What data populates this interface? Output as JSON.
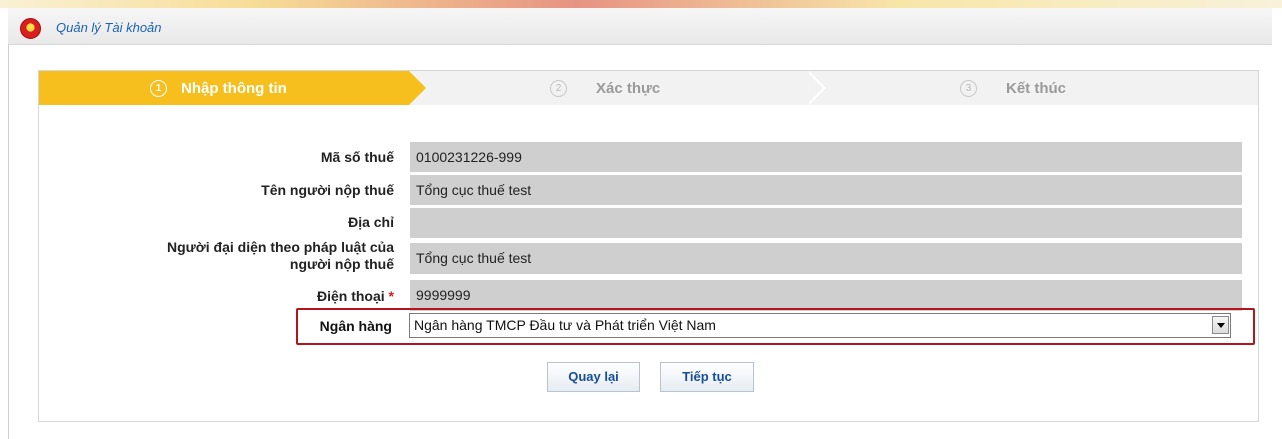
{
  "header": {
    "title": "Quản lý Tài khoản",
    "emblem_icon": "national-emblem-icon"
  },
  "wizard": {
    "steps": [
      {
        "number": "1",
        "label": "Nhập thông tin",
        "state": "active"
      },
      {
        "number": "2",
        "label": "Xác thực",
        "state": "inactive"
      },
      {
        "number": "3",
        "label": "Kết thúc",
        "state": "inactive"
      }
    ],
    "active_color": "#f6bf1e"
  },
  "form": {
    "fields": [
      {
        "label": "Mã số thuế",
        "value": "0100231226-999"
      },
      {
        "label": "Tên người nộp thuế",
        "value": "Tổng cục thuế test"
      },
      {
        "label": "Địa chỉ",
        "value": ""
      },
      {
        "label_line1": "Người đại diện theo pháp luật của",
        "label_line2": "người nộp thuế",
        "value": "Tổng cục thuế test"
      },
      {
        "label": "Điện thoại",
        "required_mark": "*",
        "value": "9999999"
      }
    ],
    "bank": {
      "label": "Ngân hàng",
      "selected": "Ngân hàng TMCP Đầu tư và Phát triển Việt Nam",
      "dropdown_icon": "chevron-down-icon",
      "highlight_color": "#b3141e"
    }
  },
  "actions": {
    "back_label": "Quay lại",
    "next_label": "Tiếp tục"
  }
}
